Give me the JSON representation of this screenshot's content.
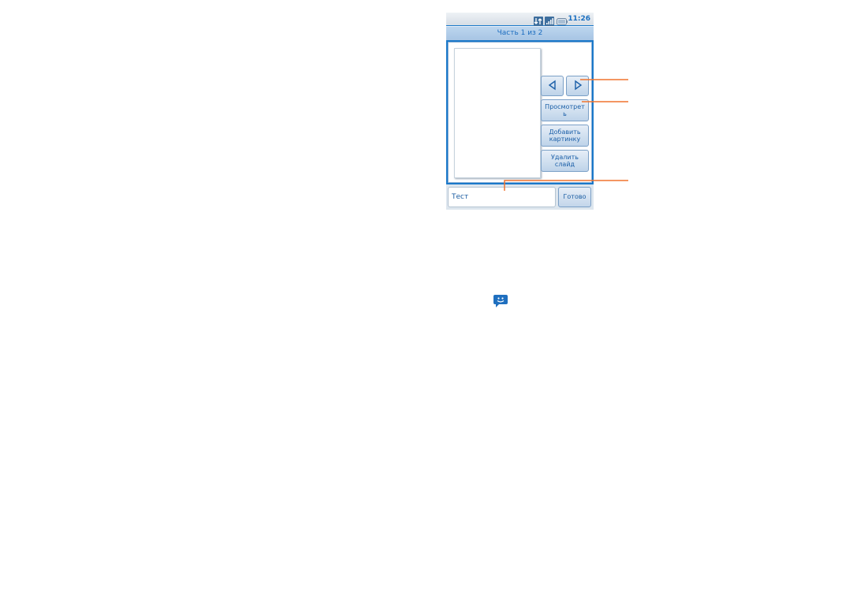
{
  "status_bar": {
    "time": "11:26",
    "icons": [
      "data-transfer-icon",
      "signal-icon",
      "battery-icon"
    ]
  },
  "title_bar": {
    "title": "Часть 1 из 2"
  },
  "slide_editor": {
    "prev_icon": "left-arrow-icon",
    "next_icon": "right-arrow-icon",
    "preview_label_line1": "Просмотрет",
    "preview_label_line2": "ь",
    "add_picture_line1": "Добавить",
    "add_picture_line2": "картинку",
    "delete_slide_line1": "Удалить",
    "delete_slide_line2": "слайд"
  },
  "composer": {
    "text_value": "Тест",
    "done_label": "Готово"
  },
  "inline_icon": "smiley-message-icon",
  "colors": {
    "accent": "#1a78c9",
    "callout": "#f0742f"
  }
}
